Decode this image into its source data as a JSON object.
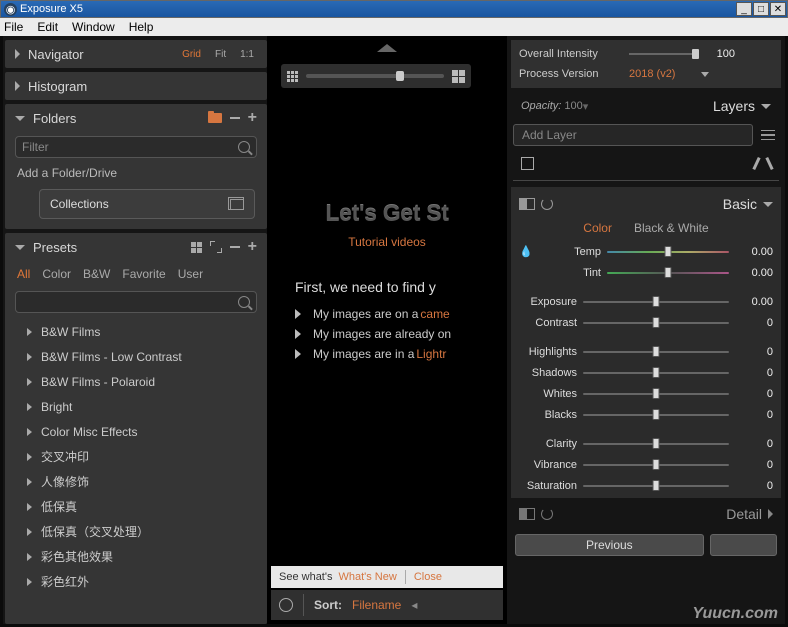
{
  "title": "Exposure X5",
  "menus": [
    "File",
    "Edit",
    "Window",
    "Help"
  ],
  "left": {
    "navigator": {
      "title": "Navigator",
      "grid": "Grid",
      "fit": "Fit",
      "one": "1:1"
    },
    "histogram": {
      "title": "Histogram"
    },
    "folders": {
      "title": "Folders",
      "filter_placeholder": "Filter",
      "add_label": "Add a Folder/Drive",
      "collections": "Collections"
    },
    "presets": {
      "title": "Presets",
      "tabs": [
        "All",
        "Color",
        "B&W",
        "Favorite",
        "User"
      ],
      "filter_placeholder": "",
      "items": [
        "B&W Films",
        "B&W Films - Low Contrast",
        "B&W Films - Polaroid",
        "Bright",
        "Color Misc Effects",
        "交叉冲印",
        "人像修饰",
        "低保真",
        "低保真（交叉处理）",
        "彩色其他效果",
        "彩色红外"
      ]
    }
  },
  "center": {
    "headline": "Let's Get St",
    "tutorial": "Tutorial videos",
    "first": "First, we need to find y",
    "opts": [
      {
        "pre": "My images are on a",
        "post": "came"
      },
      {
        "pre": "My images are already on",
        "post": ""
      },
      {
        "pre": "My images are in a",
        "post": "Lightr"
      }
    ],
    "whats_bar": {
      "a": "See what's",
      "b": "What's New",
      "c": "Close"
    },
    "sort": {
      "label": "Sort:",
      "value": "Filename"
    }
  },
  "right": {
    "intensity": {
      "label": "Overall Intensity",
      "value": "100"
    },
    "process": {
      "label": "Process Version",
      "value": "2018 (v2)"
    },
    "opacity": {
      "label": "Opacity:",
      "value": "100"
    },
    "layers": "Layers",
    "add_layer": "Add Layer",
    "basic": {
      "title": "Basic",
      "tabs": {
        "color": "Color",
        "bw": "Black & White"
      },
      "rows": [
        {
          "label": "Temp",
          "value": "0.00",
          "style": "rainbow",
          "eye": true
        },
        {
          "label": "Tint",
          "value": "0.00",
          "style": "tint",
          "eye": false
        }
      ],
      "rows2": [
        {
          "label": "Exposure",
          "value": "0.00"
        },
        {
          "label": "Contrast",
          "value": "0"
        }
      ],
      "rows3": [
        {
          "label": "Highlights",
          "value": "0"
        },
        {
          "label": "Shadows",
          "value": "0"
        },
        {
          "label": "Whites",
          "value": "0"
        },
        {
          "label": "Blacks",
          "value": "0"
        }
      ],
      "rows4": [
        {
          "label": "Clarity",
          "value": "0"
        },
        {
          "label": "Vibrance",
          "value": "0"
        },
        {
          "label": "Saturation",
          "value": "0"
        }
      ]
    },
    "detail": "Detail",
    "prev": "Previous"
  },
  "watermark": "Yuucn.com"
}
